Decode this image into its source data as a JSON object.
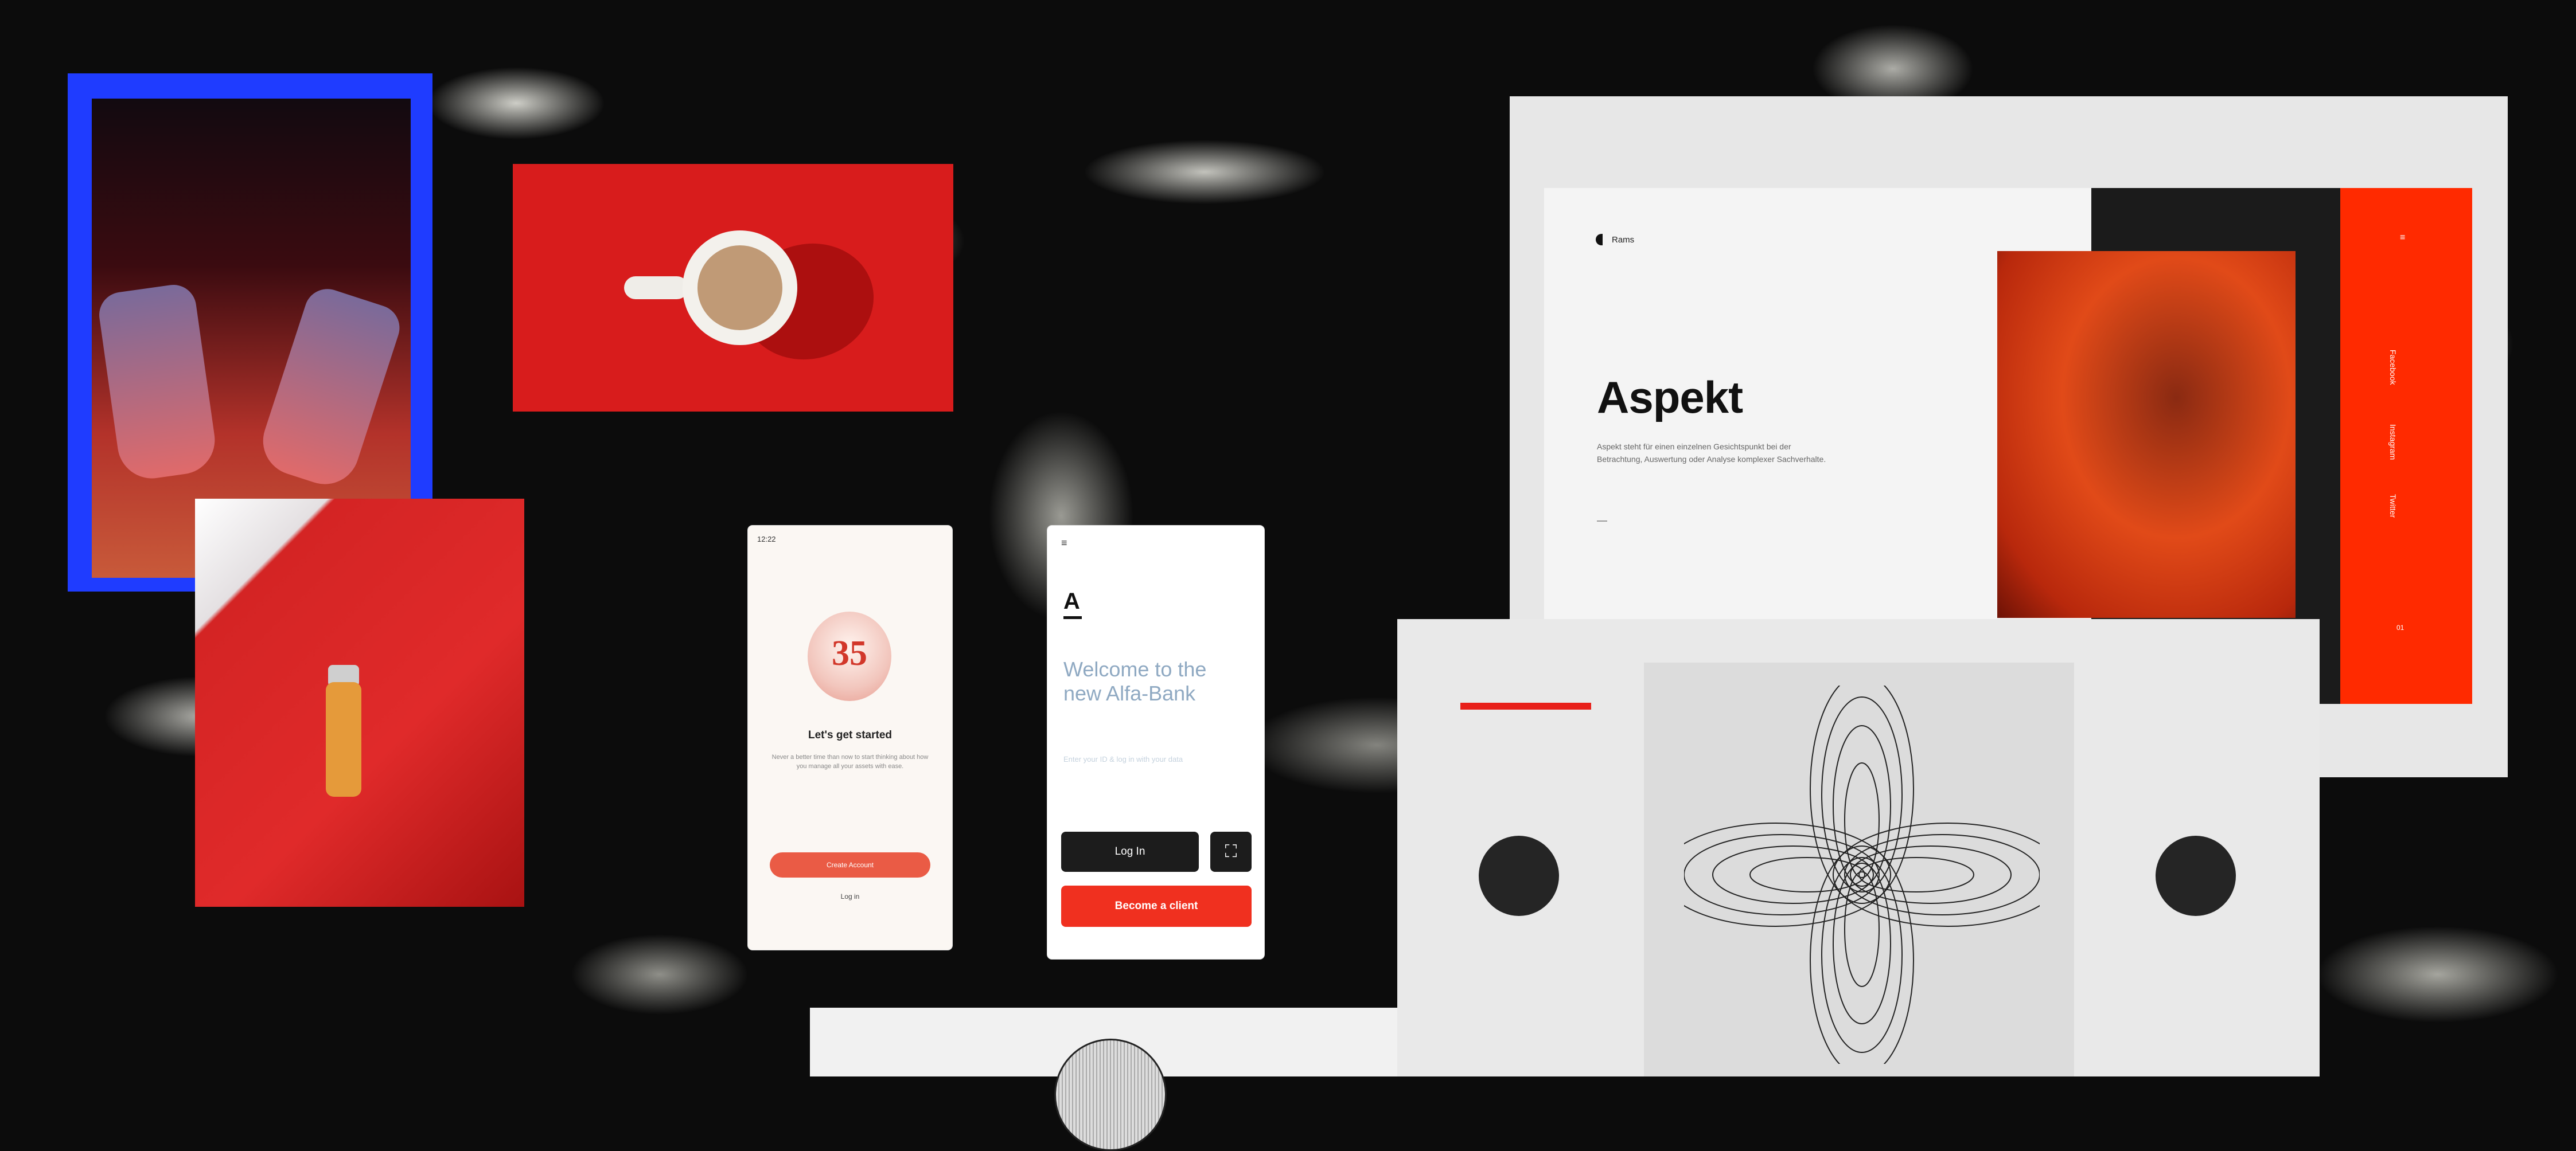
{
  "phone_onboarding": {
    "status_time": "12:22",
    "badge_text": "35",
    "title": "Let's get started",
    "body": "Never a better time than now to start thinking about how you manage all your assets with ease.",
    "create_account_label": "Create Account",
    "login_label": "Log in"
  },
  "phone_bank": {
    "menu_icon": "≡",
    "logo": "A",
    "welcome": "Welcome to the new Alfa-Bank",
    "subtitle": "Enter your ID & log in with your data",
    "login_label": "Log In",
    "face_id_icon": "face-id-icon",
    "become_client_label": "Become a client"
  },
  "aspekt_site": {
    "brand": "Rams",
    "title": "Aspekt",
    "description": "Aspekt steht für einen einzelnen Gesichtspunkt bei der Betrachtung, Auswertung oder Analyse komplexer Sachverhalte.",
    "nav": [
      "Facebook",
      "Instagram",
      "Twitter"
    ],
    "menu_icon": "≡",
    "counter": "01"
  },
  "colors": {
    "blue_frame": "#1f3cff",
    "accent_red": "#f0301f",
    "aspekt_red": "#ff2a00",
    "dark": "#1b1b1b"
  }
}
